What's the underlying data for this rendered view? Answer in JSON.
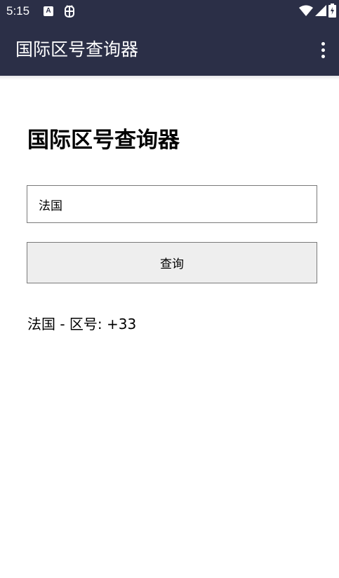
{
  "status_bar": {
    "time": "5:15",
    "notification_a_glyph": "A",
    "icons": [
      "a-notification-icon",
      "bug-notification-icon",
      "wifi-icon",
      "signal-icon",
      "battery-icon"
    ]
  },
  "app_bar": {
    "title": "国际区号查询器",
    "overflow_icon": "more-vert-icon",
    "background_color": "#2b2f47"
  },
  "main": {
    "heading": "国际区号查询器",
    "country_input": {
      "value": "法国",
      "placeholder": ""
    },
    "query_button_label": "查询",
    "result": "法国 - 区号: +33"
  }
}
